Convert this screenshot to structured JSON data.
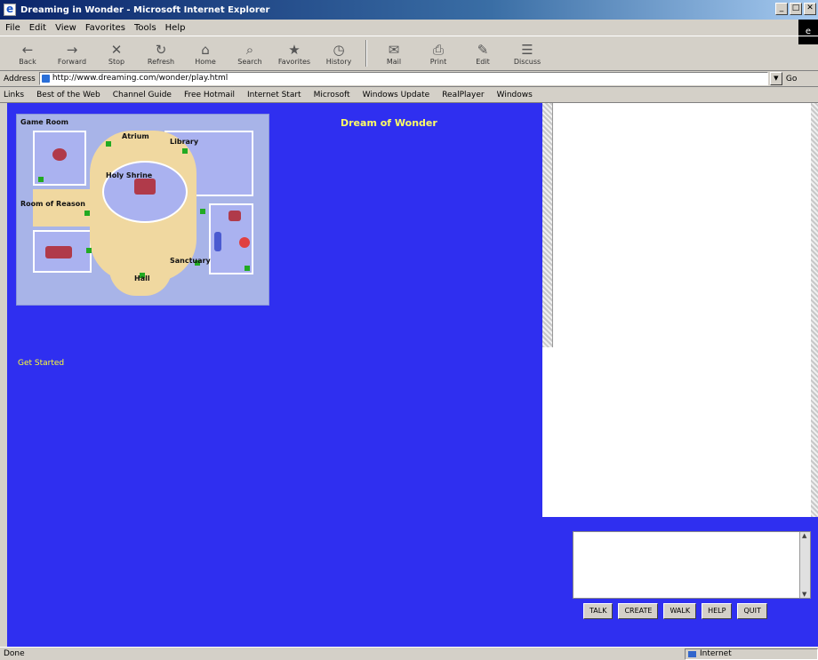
{
  "window": {
    "title": "Dreaming in Wonder - Microsoft Internet Explorer"
  },
  "menu": [
    "File",
    "Edit",
    "View",
    "Favorites",
    "Tools",
    "Help"
  ],
  "toolbar": [
    {
      "label": "Back",
      "icon": "back-arrow-icon",
      "glyph": "←"
    },
    {
      "label": "Forward",
      "icon": "forward-arrow-icon",
      "glyph": "→"
    },
    {
      "label": "Stop",
      "icon": "stop-icon",
      "glyph": "✕"
    },
    {
      "label": "Refresh",
      "icon": "refresh-icon",
      "glyph": "↻"
    },
    {
      "label": "Home",
      "icon": "home-icon",
      "glyph": "⌂"
    },
    {
      "label": "Search",
      "icon": "search-icon",
      "glyph": "⌕"
    },
    {
      "label": "Favorites",
      "icon": "favorites-icon",
      "glyph": "★"
    },
    {
      "label": "History",
      "icon": "history-icon",
      "glyph": "◷"
    },
    {
      "label": "Mail",
      "icon": "mail-icon",
      "glyph": "✉"
    },
    {
      "label": "Print",
      "icon": "print-icon",
      "glyph": "⎙"
    },
    {
      "label": "Edit",
      "icon": "edit-icon",
      "glyph": "✎"
    },
    {
      "label": "Discuss",
      "icon": "discuss-icon",
      "glyph": "☰"
    }
  ],
  "address": {
    "label": "Address",
    "url": "http://www.dreaming.com/wonder/play.html",
    "go": "Go"
  },
  "links": [
    "Links",
    "Best of the Web",
    "Channel Guide",
    "Free Hotmail",
    "Internet Start",
    "Microsoft",
    "Windows Update",
    "RealPlayer",
    "Windows"
  ],
  "map": {
    "labels": {
      "game_room": "Game Room",
      "atrium": "Atrium",
      "library": "Library",
      "holy_shrine": "Holy Shrine",
      "room_of_reason": "Room of Reason",
      "hall": "Hall",
      "sanctuary": "Sanctuary"
    }
  },
  "welcome": "Dream of Wonder",
  "nav_link": "Get Started",
  "commands": [
    "TALK",
    "CREATE",
    "WALK",
    "HELP",
    "QUIT"
  ],
  "status": {
    "left": "Done",
    "zone": "Internet"
  }
}
